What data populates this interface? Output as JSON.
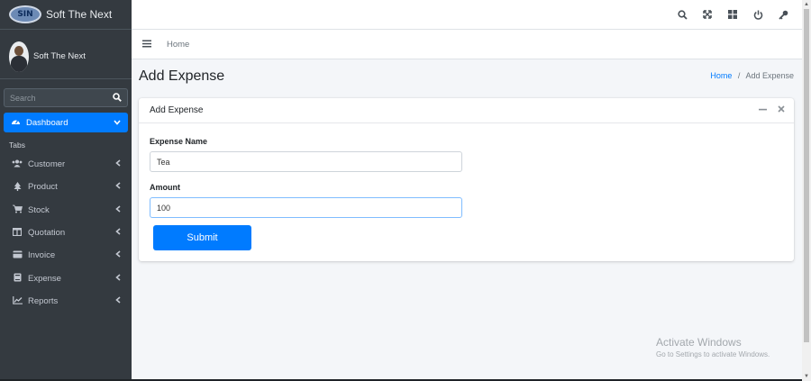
{
  "brand": {
    "logo_text": "SIN",
    "name": "Soft The Next"
  },
  "user": {
    "name": "Soft The Next"
  },
  "sidebar": {
    "search_placeholder": "Search",
    "active_item": "Dashboard",
    "section_header": "Tabs",
    "items": [
      {
        "label": "Customer",
        "icon": "users-icon"
      },
      {
        "label": "Product",
        "icon": "tree-icon"
      },
      {
        "label": "Stock",
        "icon": "cart-icon"
      },
      {
        "label": "Quotation",
        "icon": "columns-icon"
      },
      {
        "label": "Invoice",
        "icon": "credit-card-icon"
      },
      {
        "label": "Expense",
        "icon": "book-icon"
      },
      {
        "label": "Reports",
        "icon": "chart-line-icon"
      }
    ]
  },
  "topbar": {
    "icons": [
      "search-icon",
      "fullscreen-icon",
      "grid-icon",
      "power-icon",
      "key-icon"
    ]
  },
  "secbar": {
    "home_label": "Home"
  },
  "content": {
    "title": "Add Expense",
    "breadcrumb": {
      "home": "Home",
      "separator": "/",
      "current": "Add Expense"
    }
  },
  "card": {
    "title": "Add Expense",
    "fields": {
      "expense_name": {
        "label": "Expense Name",
        "value": "Tea"
      },
      "amount": {
        "label": "Amount",
        "value": "100"
      }
    },
    "submit_label": "Submit"
  },
  "watermark": {
    "line1": "Activate Windows",
    "line2": "Go to Settings to activate Windows."
  },
  "colors": {
    "accent": "#007bff",
    "sidebar_bg": "#343a40",
    "content_bg": "#f4f6f9"
  }
}
